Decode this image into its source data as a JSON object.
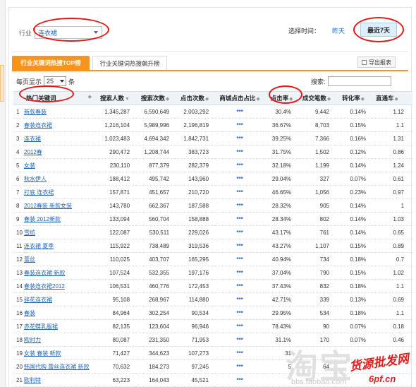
{
  "filter": {
    "industry_label": "行业",
    "industry_value": "连衣裙",
    "time_label": "选择时间：",
    "time_yesterday": "昨天",
    "time_last7": "最近7天"
  },
  "tabs": {
    "active": "行业关键词热搜TOP榜",
    "inactive": "行业关键词热搜飙升榜"
  },
  "export_label": "导出报表",
  "perpage": {
    "prefix": "每页显示",
    "value": "25",
    "suffix": "条"
  },
  "search_label": "搜索:",
  "columns": [
    "热门关键词",
    "搜索人数",
    "搜索次数",
    "点击次数",
    "商城点击占比",
    "点击率",
    "成交笔数",
    "转化率",
    "直通车"
  ],
  "rows": [
    [
      "1",
      "新款春装",
      "1,345,287",
      "6,590,649",
      "2,003,292",
      "***",
      "30.4%",
      "9,442",
      "0.14%",
      "1.12"
    ],
    [
      "2",
      "春装连衣裙",
      "1,216,104",
      "5,989,996",
      "2,196,819",
      "***",
      "36.67%",
      "8,703",
      "0.15%",
      "1.1"
    ],
    [
      "3",
      "连衣裙",
      "1,023,483",
      "4,694,342",
      "1,842,731",
      "***",
      "39.25%",
      "7,366",
      "0.16%",
      "1.31"
    ],
    [
      "4",
      "2012春",
      "290,472",
      "1,208,744",
      "383,723",
      "***",
      "31.75%",
      "1,502",
      "0.12%",
      "0.86"
    ],
    [
      "5",
      "女装",
      "230,110",
      "877,379",
      "282,379",
      "***",
      "32.18%",
      "1,199",
      "0.14%",
      "1.24"
    ],
    [
      "6",
      "秋水伊人",
      "188,412",
      "495,742",
      "143,960",
      "***",
      "29.04%",
      "327",
      "0.07%",
      "0.61"
    ],
    [
      "7",
      "打底 连衣裙",
      "157,871",
      "451,657",
      "210,720",
      "***",
      "46.65%",
      "1,056",
      "0.23%",
      "0.97"
    ],
    [
      "8",
      "2012春装 新款女装",
      "143,780",
      "662,367",
      "187,588",
      "***",
      "28.32%",
      "905",
      "0.14%",
      "1"
    ],
    [
      "9",
      "春装 2012新款",
      "133,094",
      "560,704",
      "158,888",
      "***",
      "28.34%",
      "802",
      "0.14%",
      "1.03"
    ],
    [
      "10",
      "雪纺",
      "122,087",
      "530,511",
      "229,026",
      "***",
      "43.17%",
      "761",
      "0.14%",
      "0.65"
    ],
    [
      "11",
      "连衣裙 夏季",
      "115,922",
      "738,489",
      "319,536",
      "***",
      "43.27%",
      "1,107",
      "0.15%",
      "0.89"
    ],
    [
      "12",
      "蕾丝",
      "110,025",
      "403,707",
      "165,295",
      "***",
      "40.94%",
      "734",
      "0.18%",
      "0.7"
    ],
    [
      "13",
      "春装连衣裙 新款",
      "107,524",
      "532,355",
      "197,176",
      "***",
      "37.04%",
      "790",
      "0.15%",
      "1.02"
    ],
    [
      "14",
      "春装连衣裙2012",
      "106,531",
      "460,776",
      "172,453",
      "***",
      "37.43%",
      "832",
      "0.18%",
      "1.1"
    ],
    [
      "15",
      "碎花连衣裙",
      "95,108",
      "268,967",
      "114,880",
      "***",
      "42.71%",
      "339",
      "0.13%",
      "0.69"
    ],
    [
      "16",
      "春装",
      "84,964",
      "302,254",
      "90,534",
      "***",
      "29.95%",
      "534",
      "0.18%",
      "1.1"
    ],
    [
      "17",
      "赤花蝶乳服裙",
      "82,135",
      "123,604",
      "96,946",
      "***",
      "78.43%",
      "90",
      "0.07%",
      "0.18"
    ],
    [
      "18",
      "欧时力",
      "80,087",
      "231,350",
      "71,953",
      "***",
      "31.1%",
      "170",
      "0.07%",
      "0.46"
    ],
    [
      "19",
      "女装 春装 新款",
      "71,427",
      "344,623",
      "107,273",
      "***",
      "31",
      "",
      "",
      ""
    ],
    [
      "20",
      "韩国代购 蕾丝连衣裙 新款",
      "70,632",
      "184,273",
      "97,245",
      "***",
      "5",
      "64",
      "",
      ""
    ],
    [
      "21",
      "欧利特",
      "63,223",
      "164,043",
      "45,521",
      "***",
      "",
      "",
      "",
      ""
    ]
  ],
  "watermarks": {
    "big": "淘宝",
    "url": "bbs.taobao.com",
    "red1": "货源批发网",
    "red2": "6pf.cn"
  },
  "annotation_color": "#e01818",
  "accent_color": "#f7941d",
  "link_color": "#2366b5"
}
